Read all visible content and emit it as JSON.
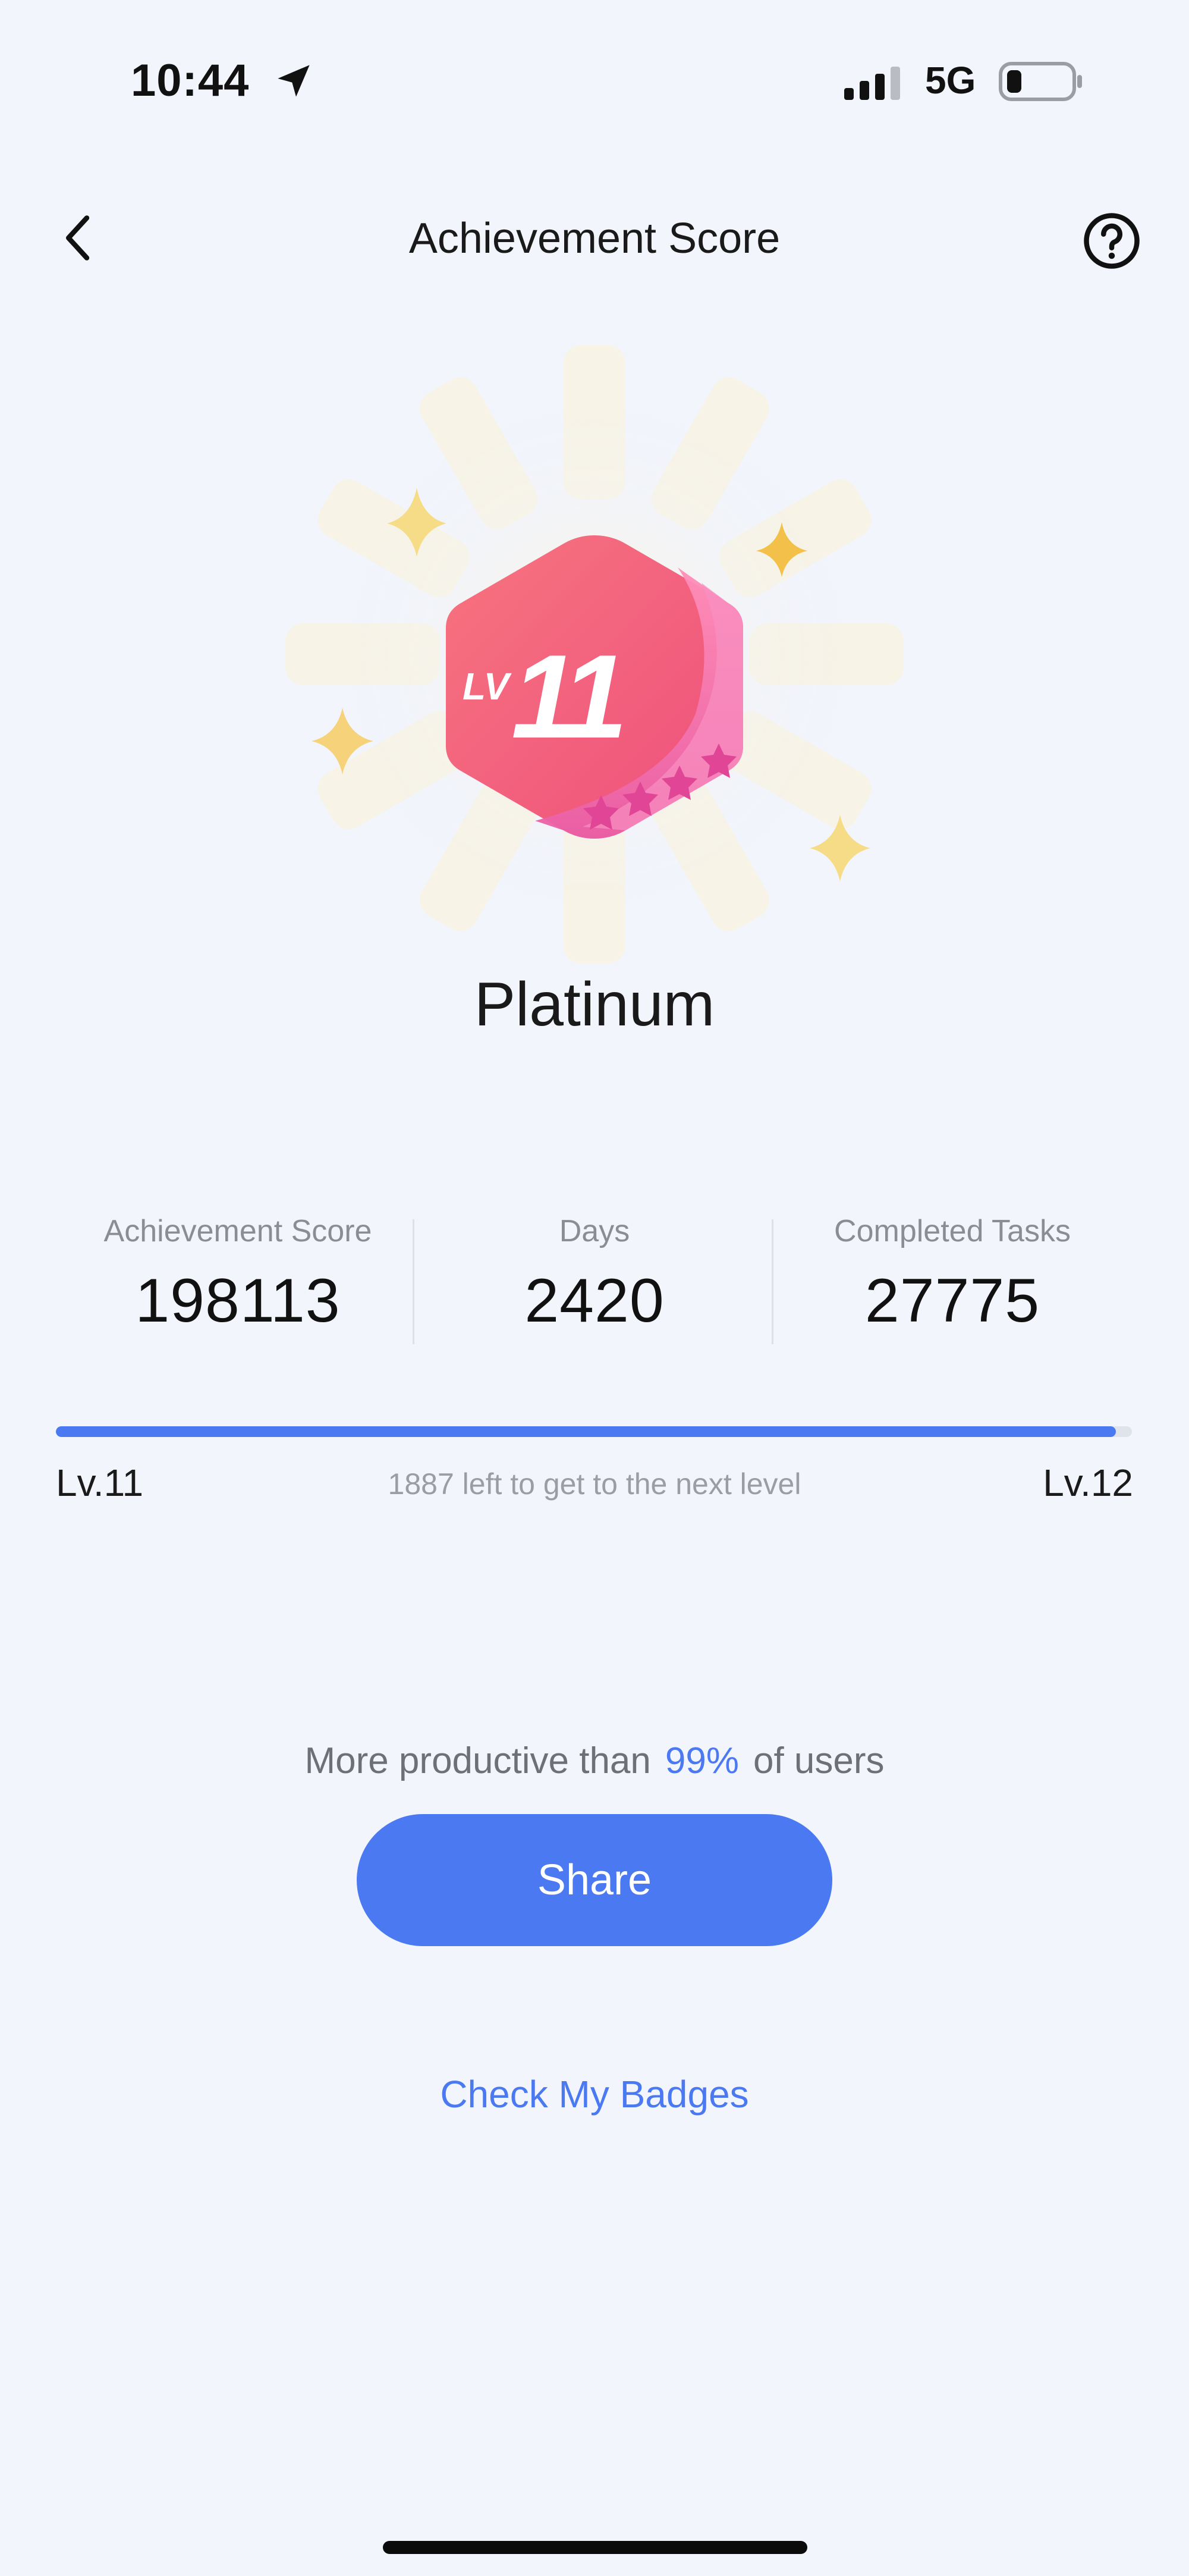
{
  "status_bar": {
    "time": "10:44",
    "network": "5G",
    "icons": [
      "location-arrow-icon",
      "signal-icon",
      "battery-icon"
    ]
  },
  "header": {
    "title": "Achievement Score",
    "icons": [
      "chevron-left-icon",
      "help-circle-icon"
    ]
  },
  "badge": {
    "prefix": "LV",
    "level_number": "11",
    "tier": "Platinum",
    "colors": {
      "hex_top": "#f7747f",
      "hex_bottom": "#e8469a",
      "stars": "#f3c14a"
    }
  },
  "stats": [
    {
      "label": "Achievement Score",
      "value": "198113"
    },
    {
      "label": "Days",
      "value": "2420"
    },
    {
      "label": "Completed Tasks",
      "value": "27775"
    }
  ],
  "progress": {
    "current_level": "Lv.11",
    "next_level": "Lv.12",
    "message": "1887 left to get to the next level",
    "fraction": 0.985
  },
  "productivity": {
    "prefix": "More productive than",
    "percent": "99%",
    "suffix": "of users"
  },
  "share_label": "Share",
  "badges_link": "Check My Badges",
  "colors": {
    "accent": "#4a79f2",
    "background": "#f2f5fc"
  }
}
